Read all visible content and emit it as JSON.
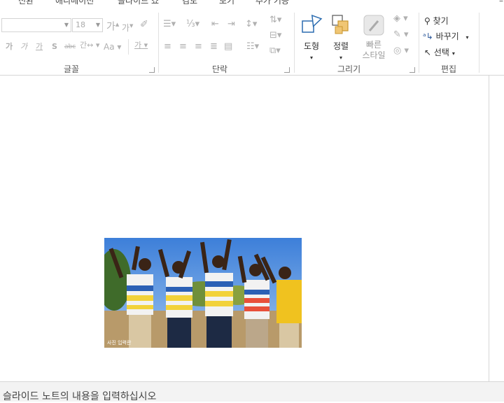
{
  "tabs": [
    {
      "label": "전환"
    },
    {
      "label": "애니메이션"
    },
    {
      "label": "슬라이드 쇼"
    },
    {
      "label": "검토"
    },
    {
      "label": "보기"
    },
    {
      "label": "추가 기능"
    }
  ],
  "ribbon": {
    "font": {
      "label": "글꼴",
      "font_name_value": "",
      "font_size_value": "18",
      "grow": "가",
      "shrink": "가",
      "bold": "가",
      "italic": "가",
      "underline": "가",
      "shadow": "S",
      "strike": "abc",
      "spacing": "간",
      "case": "Aa",
      "color": "가"
    },
    "paragraph": {
      "label": "단락"
    },
    "drawing": {
      "label": "그리기",
      "shapes": "도형",
      "arrange": "정렬",
      "quick_styles": "빠른\n스타일"
    },
    "editing": {
      "label": "편집",
      "find": "찾기",
      "replace": "바꾸기",
      "select": "선택"
    }
  },
  "slide": {
    "photo_caption": "사진 입력란"
  },
  "notes": {
    "placeholder": "슬라이드 노트의 내용을 입력하십시오"
  },
  "colors": {
    "accent": "#2b579a",
    "ribbon_bg": "#ffffff",
    "notes_bg": "#f3f3f3"
  }
}
